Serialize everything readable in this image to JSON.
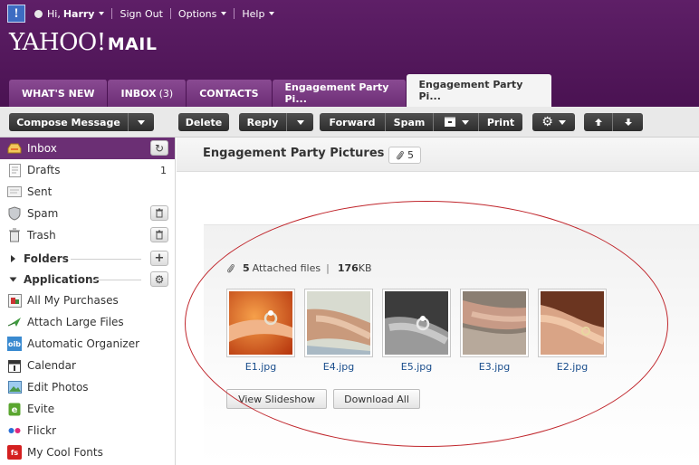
{
  "header": {
    "user_greeting": "Hi,",
    "user_name": "Harry",
    "sign_out": "Sign Out",
    "options": "Options",
    "help": "Help",
    "logo_text": "YAHOO!",
    "logo_mail": "MAIL"
  },
  "tabs": {
    "whats_new": "WHAT'S NEW",
    "inbox": "INBOX",
    "inbox_count": "(3)",
    "contacts": "CONTACTS",
    "tab1": "Engagement Party Pi...",
    "tab2_active": "Engagement Party Pi..."
  },
  "toolbar": {
    "compose": "Compose Message",
    "delete": "Delete",
    "reply": "Reply",
    "forward": "Forward",
    "spam": "Spam",
    "print": "Print"
  },
  "sidebar": {
    "inbox": "Inbox",
    "drafts": "Drafts",
    "drafts_count": "1",
    "sent": "Sent",
    "spam": "Spam",
    "trash": "Trash",
    "folders": "Folders",
    "applications": "Applications",
    "apps": [
      "All My Purchases",
      "Attach Large Files",
      "Automatic Organizer",
      "Calendar",
      "Edit Photos",
      "Evite",
      "Flickr",
      "My Cool Fonts"
    ],
    "oib_label": "oib",
    "fs_label": "fs"
  },
  "message": {
    "subject": "Engagement Party Pictures",
    "attachment_count": "5",
    "summary_count": "5",
    "summary_label": "Attached files",
    "summary_size": "176",
    "summary_unit": "KB",
    "files": [
      "E1.jpg",
      "E4.jpg",
      "E5.jpg",
      "E3.jpg",
      "E2.jpg"
    ],
    "view_slideshow": "View Slideshow",
    "download_all": "Download All"
  },
  "colors": {
    "header_purple": "#5e1f67",
    "selected_purple": "#6b2f74",
    "annotation_red": "#c0262c",
    "link_blue": "#1a4e8c"
  }
}
